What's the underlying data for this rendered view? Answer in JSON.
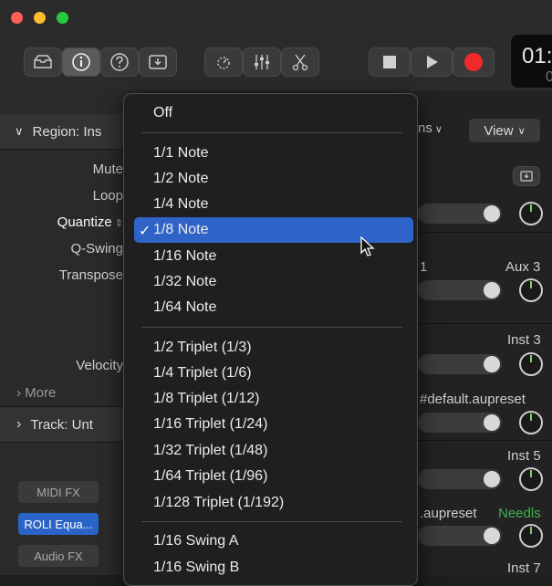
{
  "toolbar": {
    "lcd_text": "01:",
    "lcd_sub": "0"
  },
  "inspector": {
    "region_header": "Region: Ins",
    "rows": [
      "Mute",
      "Loop",
      "Quantize",
      "Q-Swing",
      "Transpose",
      "Velocity"
    ],
    "more": "More",
    "track_header": "Track: Unt",
    "midi_fx": "MIDI FX",
    "plugin": "ROLI Equa...",
    "audio_fx": "Audio FX"
  },
  "right": {
    "tab1": "ns",
    "tab2": "View",
    "labels": [
      "1",
      "Aux 3",
      "Inst 3",
      "#default.aupreset",
      "Inst 5",
      ".aupreset",
      "Needls",
      "Inst 7"
    ]
  },
  "menu": {
    "off": "Off",
    "group1": [
      "1/1 Note",
      "1/2 Note",
      "1/4 Note",
      "1/8 Note",
      "1/16 Note",
      "1/32 Note",
      "1/64 Note"
    ],
    "group2": [
      "1/2 Triplet (1/3)",
      "1/4 Triplet (1/6)",
      "1/8 Triplet (1/12)",
      "1/16 Triplet (1/24)",
      "1/32 Triplet (1/48)",
      "1/64 Triplet (1/96)",
      "1/128 Triplet (1/192)"
    ],
    "group3": [
      "1/16 Swing A",
      "1/16 Swing B"
    ],
    "selected_check": "✓",
    "highlight_color": "#2f63c8"
  }
}
